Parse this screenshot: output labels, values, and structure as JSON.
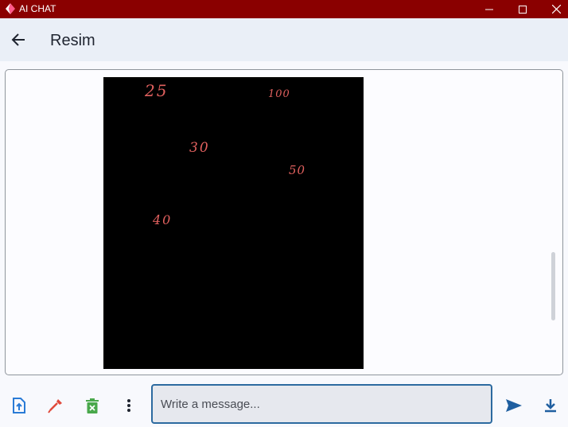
{
  "window": {
    "title": "AI CHAT"
  },
  "appbar": {
    "title": "Resim"
  },
  "image": {
    "numbers": [
      "25",
      "100",
      "30",
      "50",
      "40"
    ]
  },
  "composer": {
    "placeholder": "Write a message..."
  },
  "colors": {
    "titlebar": "#8a0000",
    "accent": "#1f5fa0",
    "handwriting": "#e0605e",
    "upload": "#2a7bd6",
    "picker": "#e04a3c",
    "delete": "#49a84b"
  },
  "icons": [
    "app-logo-icon",
    "minimize-icon",
    "maximize-icon",
    "close-icon",
    "back-arrow-icon",
    "upload-file-icon",
    "color-picker-icon",
    "delete-file-icon",
    "more-vert-icon",
    "send-icon",
    "download-icon"
  ]
}
